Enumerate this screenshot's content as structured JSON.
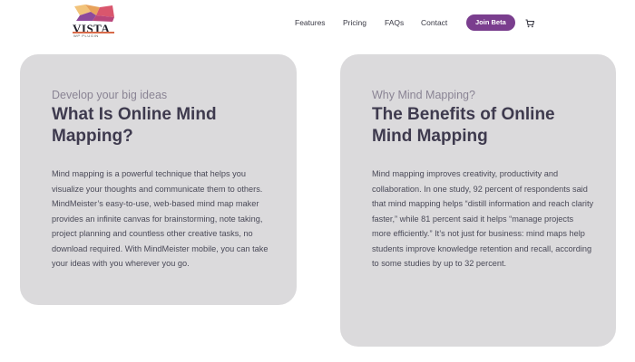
{
  "logo": {
    "brand": "VISTA",
    "tagline": "WP PLUGIN",
    "colors": [
      "#e8a25b",
      "#d9566d",
      "#8e4a9b",
      "#f2c37a"
    ]
  },
  "nav": {
    "items": [
      {
        "label": "Features"
      },
      {
        "label": "Pricing"
      },
      {
        "label": "FAQs"
      },
      {
        "label": "Contact"
      }
    ],
    "cta_label": "Join Beta",
    "cta_color": "#7a3e8e",
    "cart_icon": "shopping-cart-icon"
  },
  "cards": [
    {
      "eyebrow": "Develop your big ideas",
      "title": "What Is Online Mind Mapping?",
      "body": "Mind mapping is a powerful technique that helps you visualize your thoughts and communicate them to others. MindMeister’s easy-to-use, web-based mind map maker provides an infinite canvas for brainstorming, note taking, project planning and countless other creative tasks, no download required. With MindMeister mobile, you can take your ideas with you wherever you go."
    },
    {
      "eyebrow": "Why Mind Mapping?",
      "title": "The Benefits of Online Mind Mapping",
      "body": "Mind mapping improves creativity, productivity and collaboration. In one study, 92 percent of respondents said that mind mapping helps “distill information and reach clarity faster,” while 81 percent said it helps “manage projects more efficiently.” It’s not just for business: mind maps help students improve knowledge retention and recall, according to some studies by up to 32 percent."
    }
  ],
  "theme": {
    "card_background": "#dbdadc",
    "heading_color": "#3e3a4e"
  }
}
